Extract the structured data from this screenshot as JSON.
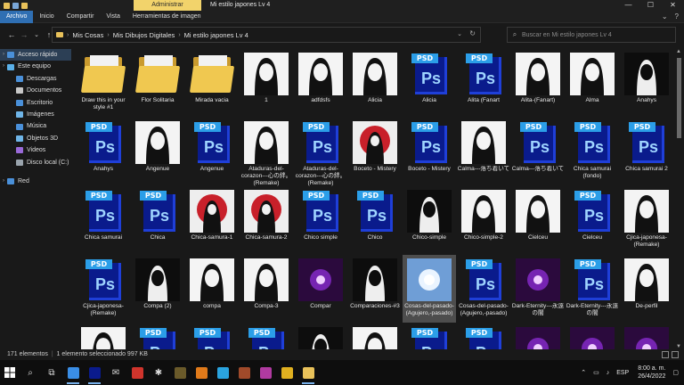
{
  "titlebar": {
    "context_tab": "Administrar",
    "window_title": "Mi estilo japones Lv 4",
    "minimize": "—",
    "maximize": "☐",
    "close": "✕"
  },
  "ribbon": {
    "tabs": [
      "Archivo",
      "Inicio",
      "Compartir",
      "Vista",
      "Herramientas de imagen"
    ]
  },
  "address": {
    "crumbs": [
      "Mis Cosas",
      "Mis Dibujos Digitales",
      "Mi estilo japones Lv 4"
    ],
    "search_placeholder": "Buscar en Mi estilo japones Lv 4"
  },
  "sidebar": {
    "items": [
      {
        "label": "Acceso rápido",
        "icon": "star-icon",
        "color": "#4a90d9",
        "indent": 0,
        "selected": true
      },
      {
        "label": "Este equipo",
        "icon": "computer-icon",
        "color": "#5ab0e8",
        "indent": 0
      },
      {
        "label": "Descargas",
        "icon": "download-icon",
        "color": "#4a90d9",
        "indent": 1
      },
      {
        "label": "Documentos",
        "icon": "document-icon",
        "color": "#c8c8c8",
        "indent": 1
      },
      {
        "label": "Escritorio",
        "icon": "desktop-icon",
        "color": "#4a90d9",
        "indent": 1
      },
      {
        "label": "Imágenes",
        "icon": "pictures-icon",
        "color": "#6fb5e8",
        "indent": 1
      },
      {
        "label": "Música",
        "icon": "music-icon",
        "color": "#4a90d9",
        "indent": 1
      },
      {
        "label": "Objetos 3D",
        "icon": "cube-icon",
        "color": "#6fb5e8",
        "indent": 1
      },
      {
        "label": "Videos",
        "icon": "video-icon",
        "color": "#9a6ad9",
        "indent": 1
      },
      {
        "label": "Disco local (C:)",
        "icon": "drive-icon",
        "color": "#9aa4ad",
        "indent": 1
      },
      {
        "label": "",
        "icon": "",
        "color": "",
        "indent": 0
      },
      {
        "label": "Red",
        "icon": "network-icon",
        "color": "#4a90d9",
        "indent": 0
      }
    ]
  },
  "files": [
    {
      "name": "Draw this in your style #1",
      "kind": "folder"
    },
    {
      "name": "Flor Solitaria",
      "kind": "folder"
    },
    {
      "name": "Mirada vacia",
      "kind": "folder"
    },
    {
      "name": "1",
      "kind": "photo",
      "style": "bw"
    },
    {
      "name": "adfdsfs",
      "kind": "photo",
      "style": "bw"
    },
    {
      "name": "Alicia",
      "kind": "photo",
      "style": "bw"
    },
    {
      "name": "Alicia",
      "kind": "psd"
    },
    {
      "name": "Alita (Fanart",
      "kind": "psd"
    },
    {
      "name": "Alita-(Fanart)",
      "kind": "photo",
      "style": "bw"
    },
    {
      "name": "Alma",
      "kind": "photo",
      "style": "bw"
    },
    {
      "name": "Anahys",
      "kind": "photo",
      "style": "dark"
    },
    {
      "name": "Anahys",
      "kind": "psd"
    },
    {
      "name": "Angenue",
      "kind": "photo",
      "style": "bw"
    },
    {
      "name": "Angenue",
      "kind": "psd"
    },
    {
      "name": "Ataduras-del-corazon---心の絆。(Remake)",
      "kind": "photo",
      "style": "bw"
    },
    {
      "name": "Ataduras-del-corazon---心の絆。(Remake)",
      "kind": "psd"
    },
    {
      "name": "Boceto - Mistery",
      "kind": "photo",
      "style": "red"
    },
    {
      "name": "Boceto - Mistery",
      "kind": "psd"
    },
    {
      "name": "Calma---落ち着いて",
      "kind": "photo",
      "style": "bw"
    },
    {
      "name": "Calma---落ち着いて",
      "kind": "psd"
    },
    {
      "name": "Chica samurai (fondo)",
      "kind": "psd"
    },
    {
      "name": "Chica samurai 2",
      "kind": "psd"
    },
    {
      "name": "Chica samurai",
      "kind": "psd"
    },
    {
      "name": "Chica",
      "kind": "psd"
    },
    {
      "name": "Chica-samura-1",
      "kind": "photo",
      "style": "red"
    },
    {
      "name": "Chica-samura-2",
      "kind": "photo",
      "style": "red"
    },
    {
      "name": "Chico simple",
      "kind": "psd"
    },
    {
      "name": "Chico",
      "kind": "psd"
    },
    {
      "name": "Chico-simple",
      "kind": "photo",
      "style": "dark"
    },
    {
      "name": "Chico-simple-2",
      "kind": "photo",
      "style": "bw"
    },
    {
      "name": "Cielceu",
      "kind": "photo",
      "style": "bw"
    },
    {
      "name": "Cielceu",
      "kind": "psd"
    },
    {
      "name": "Cjica-japonesa-(Remake)",
      "kind": "photo",
      "style": "bw"
    },
    {
      "name": "Cjica-japonesa-(Remake)",
      "kind": "psd"
    },
    {
      "name": "Compa (2)",
      "kind": "photo",
      "style": "dark"
    },
    {
      "name": "compa",
      "kind": "photo",
      "style": "bw"
    },
    {
      "name": "Compa-3",
      "kind": "photo",
      "style": "bw"
    },
    {
      "name": "Compar",
      "kind": "photo",
      "style": "purple"
    },
    {
      "name": "Comparaciones-#3",
      "kind": "photo",
      "style": "dark"
    },
    {
      "name": "Cosas-del-pasado-(Agujero,-pasado)",
      "kind": "photo",
      "style": "blue",
      "selected": true
    },
    {
      "name": "Cosas-del-pasado-(Agujero,-pasado)",
      "kind": "psd"
    },
    {
      "name": "Dark-Eternity---永遠の闇",
      "kind": "photo",
      "style": "purple"
    },
    {
      "name": "Dark-Eternity---永遠の闇",
      "kind": "psd"
    },
    {
      "name": "De-perfil",
      "kind": "photo",
      "style": "bw"
    },
    {
      "name": "",
      "kind": "photo",
      "style": "bw"
    },
    {
      "name": "",
      "kind": "psd"
    },
    {
      "name": "",
      "kind": "psd"
    },
    {
      "name": "",
      "kind": "psd"
    },
    {
      "name": "",
      "kind": "photo",
      "style": "dark"
    },
    {
      "name": "",
      "kind": "photo",
      "style": "bw"
    },
    {
      "name": "",
      "kind": "psd"
    },
    {
      "name": "",
      "kind": "psd"
    },
    {
      "name": "",
      "kind": "photo",
      "style": "purple"
    },
    {
      "name": "",
      "kind": "photo",
      "style": "purple"
    },
    {
      "name": "",
      "kind": "photo",
      "style": "purple"
    }
  ],
  "status": {
    "count": "171 elementos",
    "selection": "1 elemento seleccionado  997 KB"
  },
  "taskbar": {
    "apps": [
      {
        "icon": "search-icon",
        "color": "",
        "glyph": "⌕"
      },
      {
        "icon": "task-view-icon",
        "color": "",
        "glyph": "⧉"
      },
      {
        "icon": "file-explorer-icon",
        "color": "#3a8ee6",
        "glyph": ""
      },
      {
        "icon": "photoshop-icon",
        "color": "#0a1b8c",
        "glyph": ""
      },
      {
        "icon": "mail-icon",
        "color": "",
        "glyph": "✉"
      },
      {
        "icon": "red-app-icon",
        "color": "#d0342c",
        "glyph": ""
      },
      {
        "icon": "chat-icon",
        "color": "",
        "glyph": "✱"
      },
      {
        "icon": "game-icon",
        "color": "#6a5a2a",
        "glyph": ""
      },
      {
        "icon": "media-icon",
        "color": "#e07a1a",
        "glyph": ""
      },
      {
        "icon": "dolphin-icon",
        "color": "#2aa4e0",
        "glyph": ""
      },
      {
        "icon": "game-2-icon",
        "color": "#a04a2a",
        "glyph": ""
      },
      {
        "icon": "game-3-icon",
        "color": "#b03aa0",
        "glyph": ""
      },
      {
        "icon": "chrome-icon",
        "color": "#e0b020",
        "glyph": ""
      },
      {
        "icon": "explorer-icon",
        "color": "#e8c15a",
        "glyph": ""
      }
    ],
    "lang": "ESP",
    "time": "8:00 a. m.",
    "date": "26/4/2022"
  }
}
